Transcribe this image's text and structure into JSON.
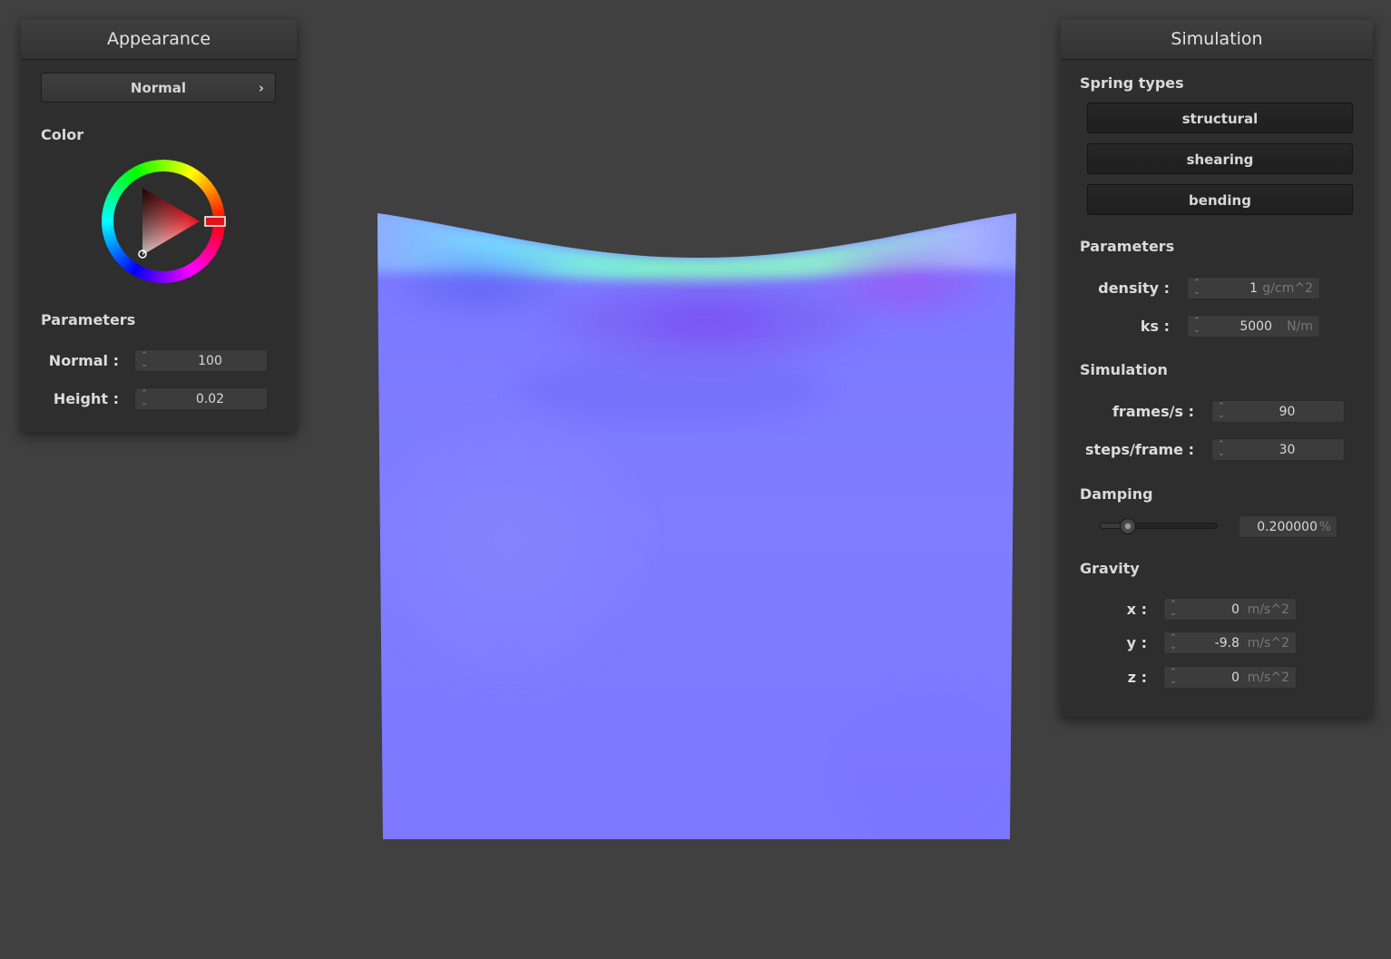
{
  "appearance": {
    "title": "Appearance",
    "shader_select": "Normal",
    "color_label": "Color",
    "selected_color": "#e0121a",
    "parameters_label": "Parameters",
    "normal_label": "Normal :",
    "normal_value": "100",
    "height_label": "Height :",
    "height_value": "0.02"
  },
  "simulation": {
    "title": "Simulation",
    "spring_types_label": "Spring types",
    "spring_types": [
      "structural",
      "shearing",
      "bending"
    ],
    "parameters_label": "Parameters",
    "density_label": "density :",
    "density_value": "1",
    "density_unit": "g/cm^2",
    "ks_label": "ks :",
    "ks_value": "5000",
    "ks_unit": "N/m",
    "simulation_label": "Simulation",
    "fps_label": "frames/s :",
    "fps_value": "90",
    "steps_label": "steps/frame :",
    "steps_value": "30",
    "damping_label": "Damping",
    "damping_value": "0.200000",
    "damping_unit": "%",
    "damping_level": 0.2,
    "gravity_label": "Gravity",
    "gravity_x_label": "x :",
    "gravity_x": "0",
    "gravity_y_label": "y :",
    "gravity_y": "-9.8",
    "gravity_z_label": "z :",
    "gravity_z": "0",
    "gravity_unit": "m/s^2"
  },
  "viewport": {
    "cloth_base_color": "#7f7cff",
    "cloth_highlight_color": "#7fe8c8",
    "cloth_fold_color": "#8a55f0"
  }
}
